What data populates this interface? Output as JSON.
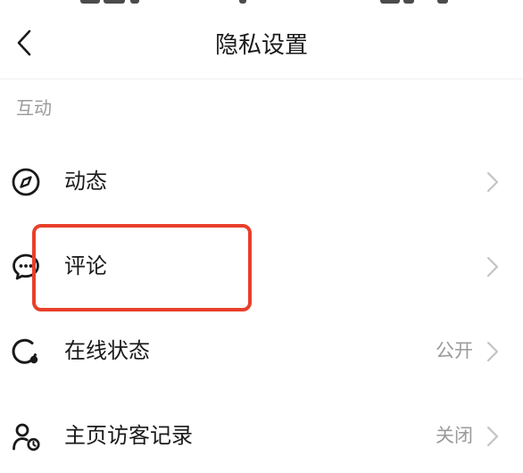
{
  "header": {
    "title": "隐私设置",
    "back_icon": "chevron-left-icon"
  },
  "section": {
    "label": "互动"
  },
  "rows": [
    {
      "label": "动态",
      "value": "",
      "icon": "compass-icon"
    },
    {
      "label": "评论",
      "value": "",
      "icon": "chat-bubble-icon"
    },
    {
      "label": "在线状态",
      "value": "公开",
      "icon": "online-status-icon"
    },
    {
      "label": "主页访客记录",
      "value": "关闭",
      "icon": "visitor-record-icon"
    }
  ],
  "colors": {
    "text_primary": "#1a1a1a",
    "text_secondary": "#9a9a9a",
    "chevron": "#c4c4c4",
    "highlight": "#e8402b"
  }
}
